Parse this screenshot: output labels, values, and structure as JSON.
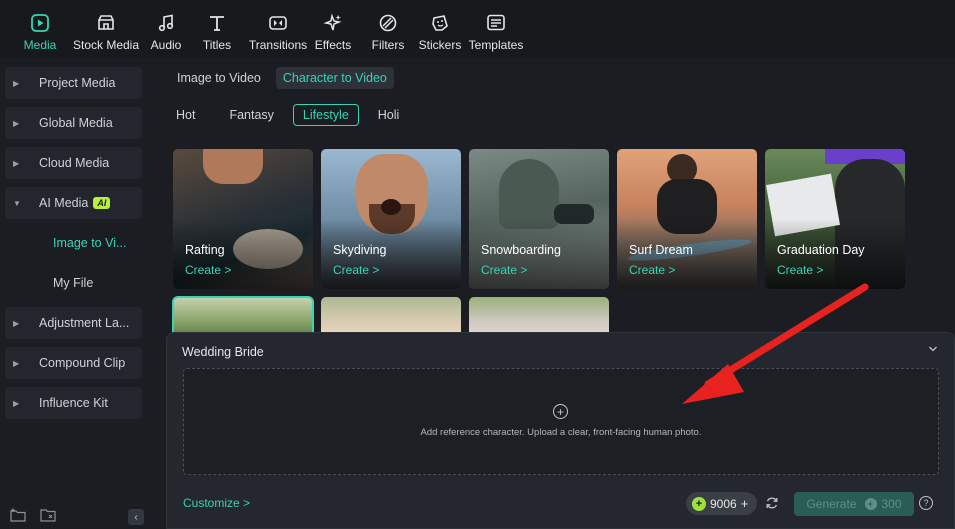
{
  "toolbar": {
    "items": [
      {
        "label": "Media",
        "icon": "media-icon",
        "active": true
      },
      {
        "label": "Stock Media",
        "icon": "stock-media-icon"
      },
      {
        "label": "Audio",
        "icon": "music-note-icon"
      },
      {
        "label": "Titles",
        "icon": "text-t-icon"
      },
      {
        "label": "Transitions",
        "icon": "transitions-icon"
      },
      {
        "label": "Effects",
        "icon": "sparkle-icon"
      },
      {
        "label": "Filters",
        "icon": "filter-icon"
      },
      {
        "label": "Stickers",
        "icon": "sticker-icon"
      },
      {
        "label": "Templates",
        "icon": "templates-icon"
      }
    ]
  },
  "sidebar": {
    "items": [
      {
        "label": "Project Media"
      },
      {
        "label": "Global Media"
      },
      {
        "label": "Cloud Media"
      },
      {
        "label": "AI Media",
        "badge": "AI",
        "expanded": true
      },
      {
        "label": "Image to Vi...",
        "sub": true,
        "active": true
      },
      {
        "label": "My File",
        "sub": true
      },
      {
        "label": "Adjustment La..."
      },
      {
        "label": "Compound Clip"
      },
      {
        "label": "Influence Kit"
      }
    ],
    "footer_icons": [
      "new-folder-icon",
      "folder-icon",
      "collapse-panel-icon"
    ]
  },
  "main": {
    "tabs": [
      {
        "label": "Image to Video"
      },
      {
        "label": "Character to Video",
        "active": true
      }
    ],
    "categories": [
      {
        "label": "Hot"
      },
      {
        "label": "Fantasy"
      },
      {
        "label": "Lifestyle",
        "active": true
      },
      {
        "label": "Holi"
      }
    ],
    "cards": [
      {
        "title": "Rafting",
        "create": "Create >"
      },
      {
        "title": "Skydiving",
        "create": "Create >"
      },
      {
        "title": "Snowboarding",
        "create": "Create >"
      },
      {
        "title": "Surf Dream",
        "create": "Create >"
      },
      {
        "title": "Graduation Day",
        "create": "Create >"
      }
    ]
  },
  "panel": {
    "title": "Wedding Bride",
    "dropzone_text": "Add reference character. Upload a clear, front-facing human photo.",
    "customize": "Customize >",
    "credits": "9006",
    "generate_label": "Generate",
    "generate_cost": "300"
  },
  "colors": {
    "accent": "#39d3b6",
    "annotation_arrow": "#e8231f"
  }
}
